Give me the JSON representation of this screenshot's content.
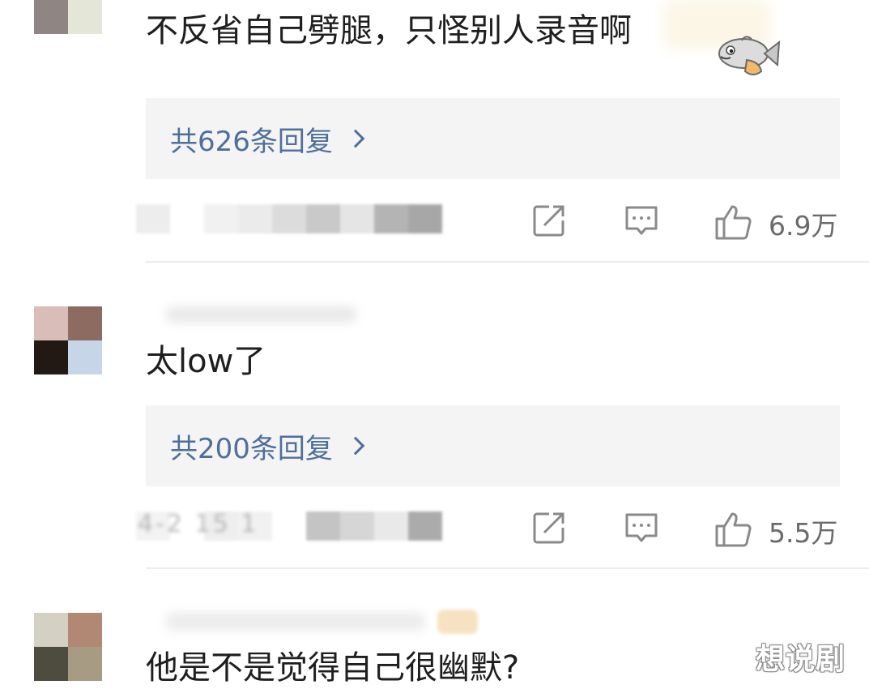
{
  "comments": [
    {
      "text": "不反省自己劈腿，只怪别人录音啊",
      "reply_link": "共626条回复",
      "like_count": "6.9万",
      "avatar_colors": [
        "#8f8582",
        "#e4e6d8"
      ]
    },
    {
      "text": "太low了",
      "reply_link": "共200条回复",
      "like_count": "5.5万",
      "meta_blurred": "4-2 15 1",
      "avatar_colors": [
        "#d8bdb9",
        "#8c6c60",
        "#231914",
        "#c7d5e9"
      ]
    },
    {
      "text": "他是不是觉得自己很幽默?",
      "avatar_colors": [
        "#d4d1c4",
        "#b18873",
        "#4e4c3f",
        "#a79b84"
      ]
    }
  ],
  "icons": {
    "share": "share-icon",
    "comment": "comment-icon",
    "like": "thumbs-up-icon",
    "emoji": "fish-emoji-icon"
  },
  "colors": {
    "reply_link": "#4f6f9a",
    "reply_box_bg": "#f4f4f5",
    "icon_gray": "#8a8a8a"
  },
  "watermark": "想说剧"
}
